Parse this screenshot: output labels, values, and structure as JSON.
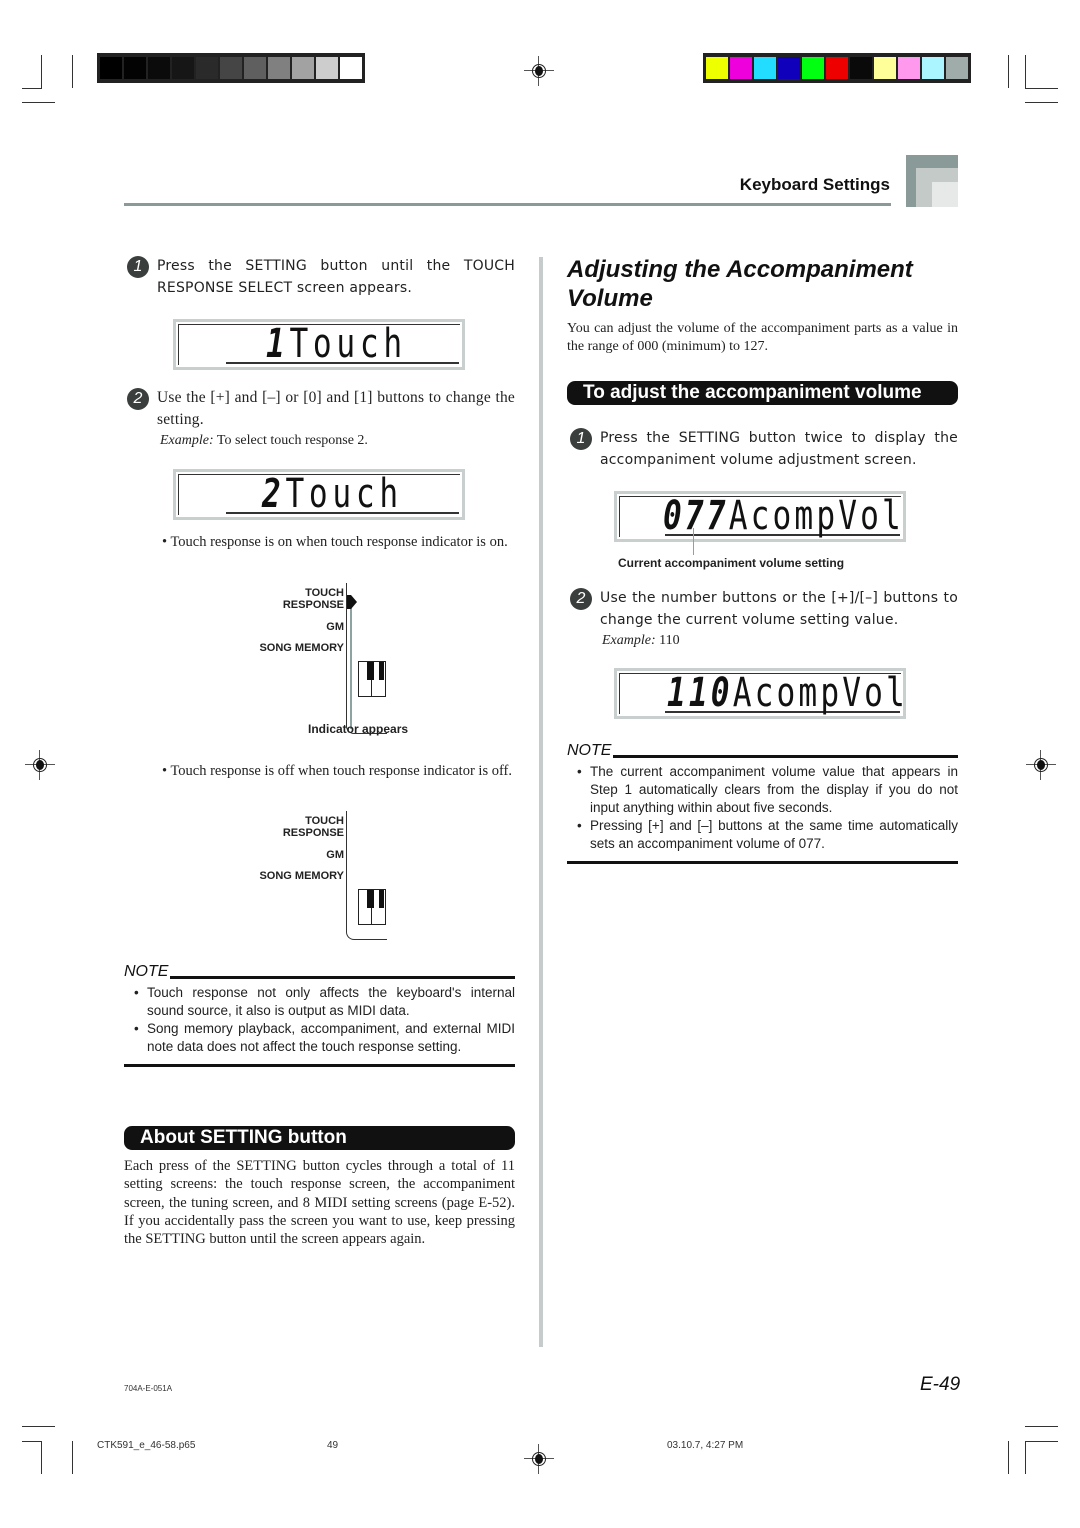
{
  "print_marks": {
    "gray_swatches": [
      "#000000",
      "#030303",
      "#0b0b0b",
      "#161616",
      "#2a2a2a",
      "#454545",
      "#5f5f5f",
      "#808080",
      "#a2a2a2",
      "#cdcdcd",
      "#ffffff"
    ],
    "color_swatches": [
      "#eeff00",
      "#ee00dd",
      "#22ddff",
      "#1100bb",
      "#00ff11",
      "#ee0000",
      "#0a0a0a",
      "#ffff99",
      "#ff99ee",
      "#aaf5ff",
      "#a0aca9"
    ]
  },
  "header": {
    "section_title": "Keyboard Settings"
  },
  "left": {
    "step1": {
      "num": "1",
      "text": "Press the SETTING button until the TOUCH RESPONSE SELECT screen appears."
    },
    "lcd1": {
      "digit": "1",
      "word": "Touch"
    },
    "step2": {
      "num": "2",
      "text": "Use the [+] and [–] or [0] and [1] buttons to change the setting."
    },
    "example": {
      "label": "Example:",
      "text": " To select touch response 2."
    },
    "lcd2": {
      "digit": "2",
      "word": "Touch"
    },
    "bullet_on": "• Touch response is on when touch response indicator is on.",
    "indicator_on": {
      "labels": [
        "TOUCH",
        "RESPONSE",
        "GM",
        "SONG MEMORY"
      ],
      "caption": "Indicator appears",
      "state": "on"
    },
    "bullet_off": "• Touch response is off when touch response indicator is off.",
    "indicator_off": {
      "labels": [
        "TOUCH",
        "RESPONSE",
        "GM",
        "SONG MEMORY"
      ],
      "state": "off"
    },
    "note": {
      "heading": "NOTE",
      "items": [
        "Touch response not only affects the keyboard's internal sound source, it also is output as MIDI data.",
        "Song memory playback, accompaniment, and external MIDI note data does not affect the touch response setting."
      ]
    },
    "about": {
      "heading": "About SETTING button",
      "body": "Each press of the SETTING button cycles through a total of 11 setting screens: the touch response screen, the accompaniment screen, the tuning screen, and 8 MIDI setting screens (page E-52). If you accidentally pass the screen you want to use, keep pressing the SETTING button until the screen appears again."
    }
  },
  "right": {
    "title": "Adjusting the Accompaniment Volume",
    "intro": "You can adjust the volume of the accompaniment parts as a value in the range of 000 (minimum) to 127.",
    "subheading": "To adjust the accompaniment volume",
    "step1": {
      "num": "1",
      "text": "Press the SETTING button twice to display the accompaniment volume adjustment screen."
    },
    "lcd1": {
      "digits": "077",
      "word": "AcompVol"
    },
    "lcd1_caption": "Current accompaniment volume setting",
    "step2": {
      "num": "2",
      "text": "Use the number buttons or the [+]/[–] buttons to change the current volume setting value."
    },
    "example": {
      "label": "Example:",
      "text": " 110"
    },
    "lcd2": {
      "digits": "110",
      "word": "AcompVol"
    },
    "note": {
      "heading": "NOTE",
      "items": [
        "The current accompaniment volume value that appears in Step 1 automatically clears from the display if you do not input anything within about five seconds.",
        "Pressing [+] and [–] buttons at the same time automatically sets an accompaniment volume of 077."
      ]
    }
  },
  "footer": {
    "doc_code": "704A-E-051A",
    "page_label": "E-49",
    "file_name": "CTK591_e_46-58.p65",
    "sheet_num": "49",
    "timestamp": "03.10.7, 4:27 PM"
  }
}
